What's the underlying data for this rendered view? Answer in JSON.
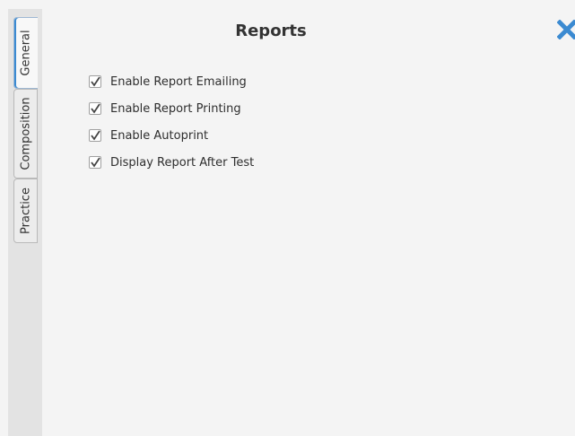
{
  "tabs": [
    {
      "label": "General",
      "selected": true
    },
    {
      "label": "Composition",
      "selected": false
    },
    {
      "label": "Practice",
      "selected": false
    }
  ],
  "panel": {
    "title": "Reports",
    "close_icon": "close-x-icon",
    "accent_color": "#3b8ad1"
  },
  "options": [
    {
      "label": "Enable Report Emailing",
      "checked": true
    },
    {
      "label": "Enable Report Printing",
      "checked": true
    },
    {
      "label": "Enable Autoprint",
      "checked": true
    },
    {
      "label": "Display Report After Test",
      "checked": true
    }
  ]
}
